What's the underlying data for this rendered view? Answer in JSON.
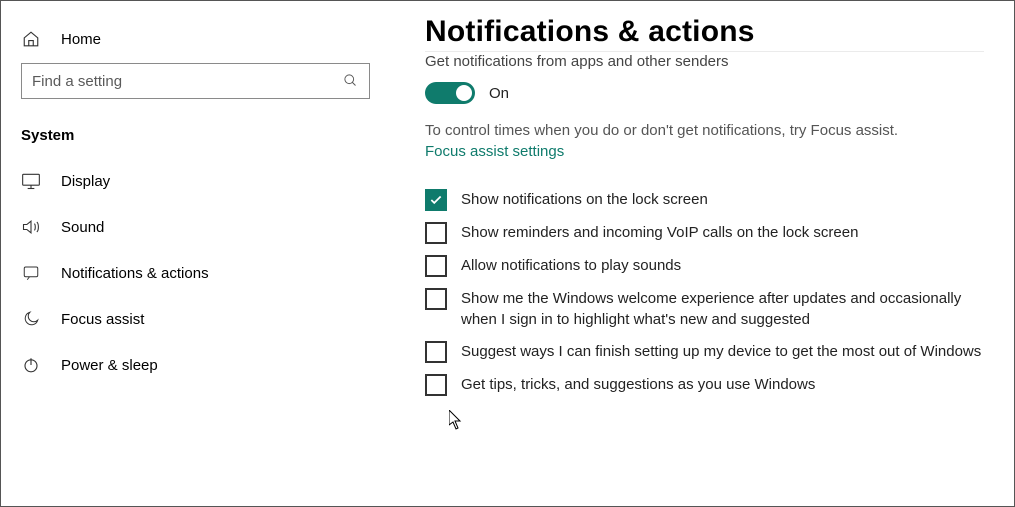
{
  "sidebar": {
    "home_label": "Home",
    "search_placeholder": "Find a setting",
    "group_label": "System",
    "items": [
      {
        "label": "Display"
      },
      {
        "label": "Sound"
      },
      {
        "label": "Notifications & actions"
      },
      {
        "label": "Focus assist"
      },
      {
        "label": "Power & sleep"
      }
    ]
  },
  "content": {
    "title": "Notifications & actions",
    "subhead": "Get notifications from apps and other senders",
    "toggle_label": "On",
    "toggle_state": "on",
    "desc": "To control times when you do or don't get notifications, try Focus assist.",
    "link_label": "Focus assist settings",
    "checkboxes": [
      {
        "checked": true,
        "label": "Show notifications on the lock screen"
      },
      {
        "checked": false,
        "label": "Show reminders and incoming VoIP calls on the lock screen"
      },
      {
        "checked": false,
        "label": "Allow notifications to play sounds"
      },
      {
        "checked": false,
        "label": "Show me the Windows welcome experience after updates and occasionally when I sign in to highlight what's new and suggested"
      },
      {
        "checked": false,
        "label": "Suggest ways I can finish setting up my device to get the most out of Windows"
      },
      {
        "checked": false,
        "label": "Get tips, tricks, and suggestions as you use Windows"
      }
    ]
  },
  "colors": {
    "accent": "#0f7b6c"
  }
}
